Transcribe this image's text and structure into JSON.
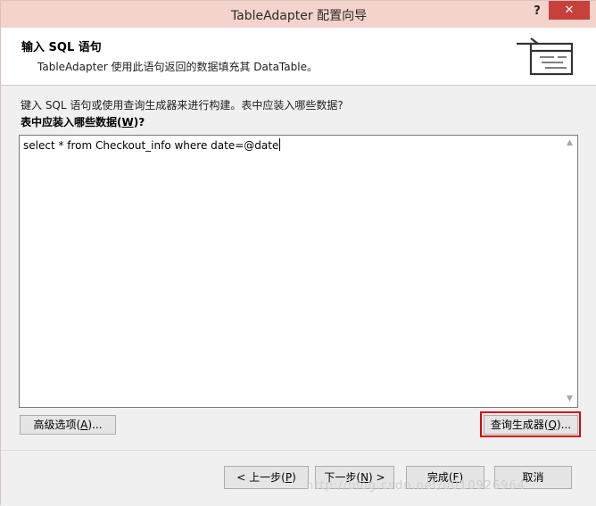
{
  "window": {
    "title": "TableAdapter 配置向导",
    "help_label": "?",
    "close_label": "✕"
  },
  "header": {
    "title": "输入 SQL 语句",
    "subtitle": "TableAdapter 使用此语句返回的数据填充其 DataTable。",
    "icon": "wizard-data-icon"
  },
  "body": {
    "instruction": "键入 SQL 语句或使用查询生成器来进行构建。表中应装入哪些数据?",
    "question_label": "表中应装入哪些数据(",
    "question_key": "W",
    "question_suffix": ")?",
    "sql_text": "select * from Checkout_info where date=@date"
  },
  "buttons": {
    "advanced": {
      "label": "高级选项(",
      "key": "A",
      "suffix": ")..."
    },
    "query_builder": {
      "label": "查询生成器(",
      "key": "Q",
      "suffix": ")..."
    },
    "prev": {
      "label": "< 上一步(",
      "key": "P",
      "suffix": ")"
    },
    "next": {
      "label": "下一步(",
      "key": "N",
      "suffix": ") >"
    },
    "finish": {
      "label": "完成(",
      "key": "F",
      "suffix": ")"
    },
    "cancel": {
      "label": "取消"
    }
  },
  "colors": {
    "highlight": "#e00000",
    "titlebar": "#f3d3cb",
    "close": "#c7403a"
  },
  "watermark": "http://blog.csdn.net/u010926964"
}
